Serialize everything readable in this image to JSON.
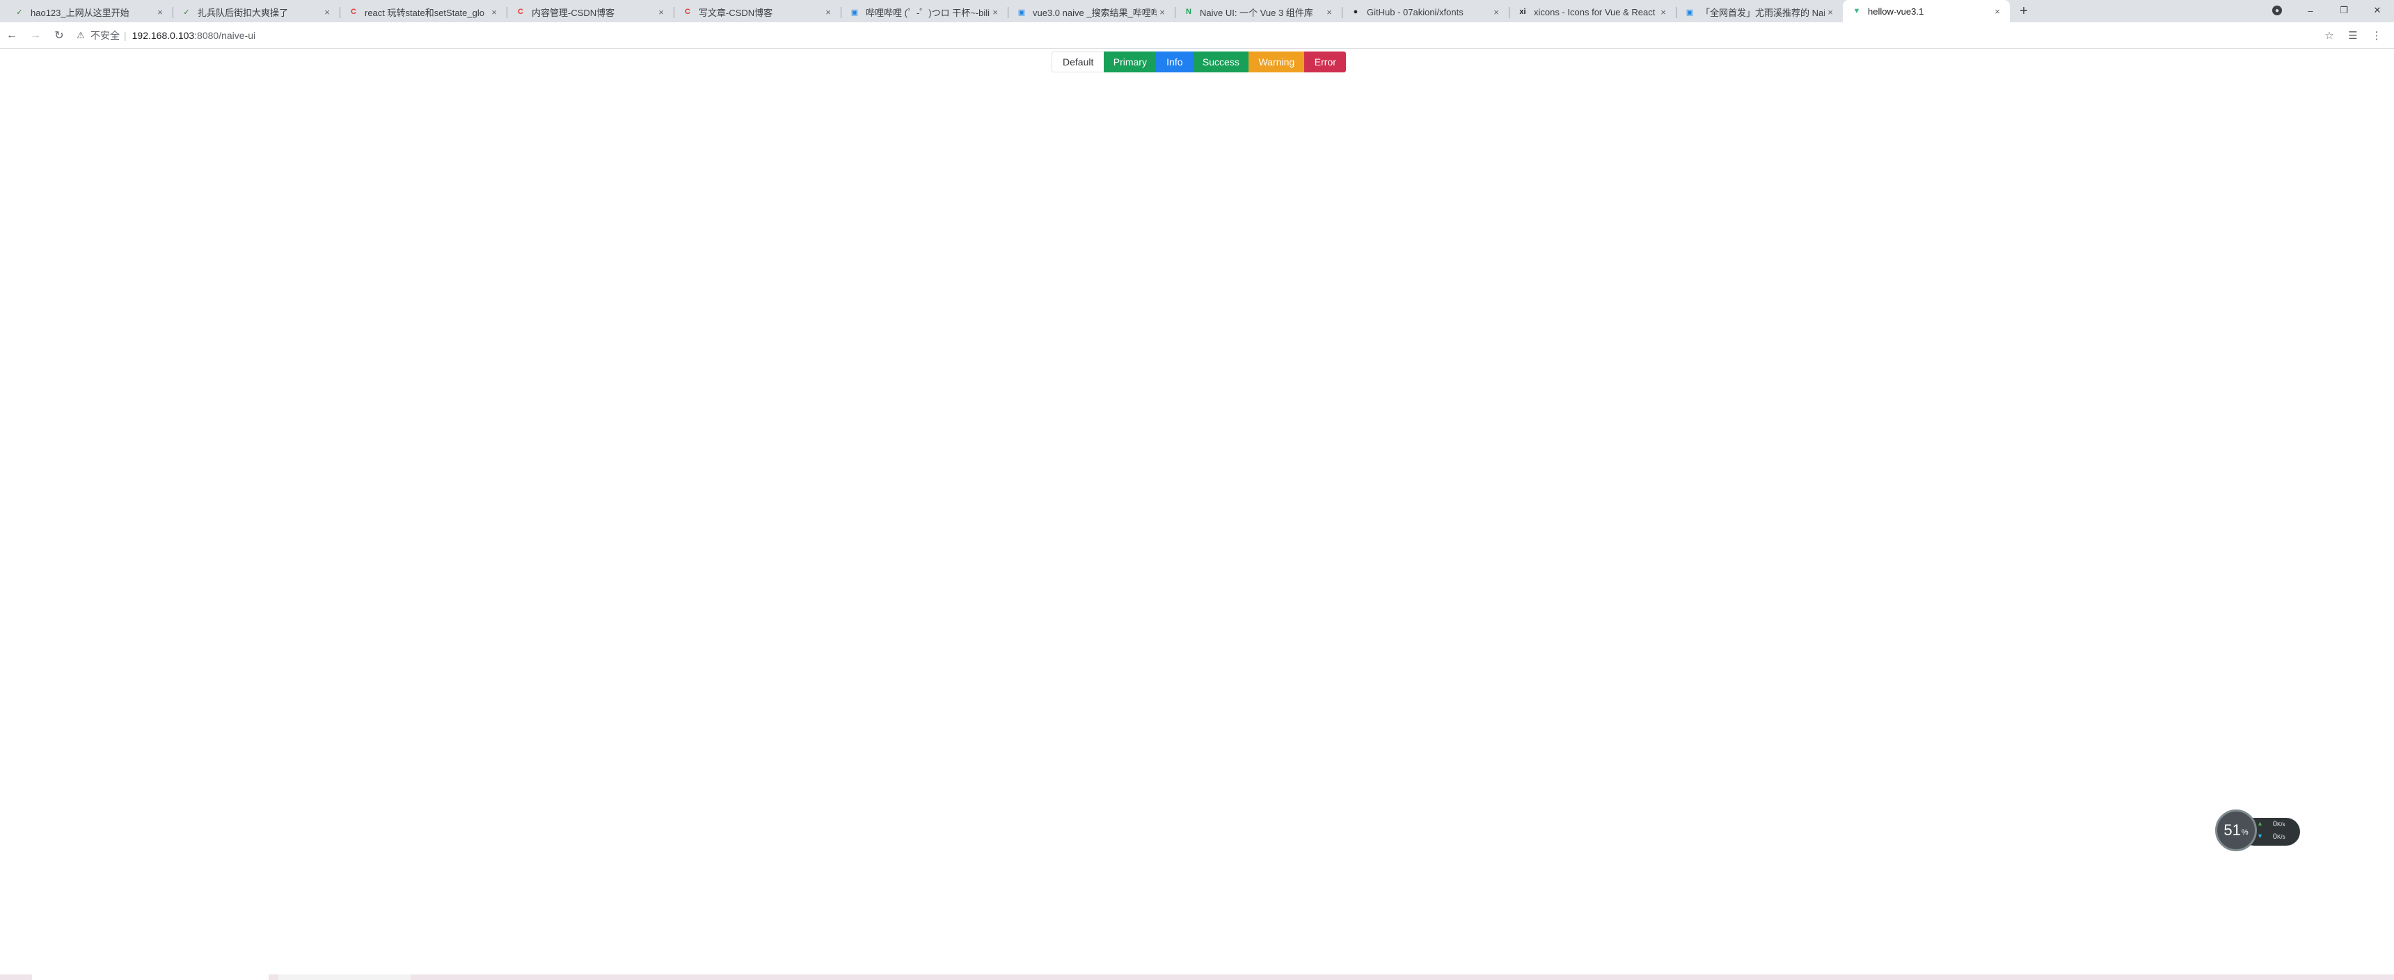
{
  "browser": {
    "tabs": [
      {
        "title": "hao123_上网从这里开始",
        "icon": "hao123-icon",
        "glyph": "✓",
        "color": "#2e7d32",
        "active": false
      },
      {
        "title": "扎兵队后街扣大爽操了",
        "icon": "hao123-icon",
        "glyph": "✓",
        "color": "#2e7d32",
        "active": false
      },
      {
        "title": "react 玩转state和setState_glo",
        "icon": "csdn-icon",
        "glyph": "C",
        "color": "#e53935",
        "active": false
      },
      {
        "title": "内容管理-CSDN博客",
        "icon": "csdn-icon",
        "glyph": "C",
        "color": "#e53935",
        "active": false
      },
      {
        "title": "写文章-CSDN博客",
        "icon": "csdn-icon",
        "glyph": "C",
        "color": "#e53935",
        "active": false
      },
      {
        "title": "哔哩哔哩 (゜-゜)つロ 干杯~-bili",
        "icon": "bilibili-icon",
        "glyph": "▣",
        "color": "#1e88e5",
        "active": false
      },
      {
        "title": "vue3.0 naive _搜索结果_哔哩哔",
        "icon": "bilibili-icon",
        "glyph": "▣",
        "color": "#1e88e5",
        "active": false
      },
      {
        "title": "Naive UI: 一个 Vue 3 组件库",
        "icon": "naive-ui-icon",
        "glyph": "N",
        "color": "#18a058",
        "active": false
      },
      {
        "title": "GitHub - 07akioni/xfonts",
        "icon": "github-icon",
        "glyph": "●",
        "color": "#24292e",
        "active": false
      },
      {
        "title": "xicons - Icons for Vue & React",
        "icon": "xicons-icon",
        "glyph": "xi",
        "color": "#202124",
        "active": false
      },
      {
        "title": "「全网首发」尤雨溪推荐的 Nai",
        "icon": "bilibili-icon",
        "glyph": "▣",
        "color": "#1e88e5",
        "active": false
      },
      {
        "title": "hellow-vue3.1",
        "icon": "vue-icon",
        "glyph": "▼",
        "color": "#42b883",
        "active": true
      }
    ],
    "close_glyph": "×",
    "new_tab_glyph": "+",
    "window": {
      "minimize": "–",
      "restore": "❐",
      "close": "✕"
    },
    "address": {
      "insecure_label": "不安全",
      "separator": "|",
      "url_host": "192.168.0.103",
      "url_rest": ":8080/naive-ui"
    }
  },
  "page": {
    "buttons": [
      {
        "label": "Default",
        "type": "default"
      },
      {
        "label": "Primary",
        "type": "primary"
      },
      {
        "label": "Info",
        "type": "info"
      },
      {
        "label": "Success",
        "type": "success"
      },
      {
        "label": "Warning",
        "type": "warning"
      },
      {
        "label": "Error",
        "type": "error"
      }
    ]
  },
  "widget": {
    "value": "51",
    "unit": "%",
    "up": {
      "value": "0",
      "unit": "K/s"
    },
    "down": {
      "value": "0",
      "unit": "K/s"
    }
  },
  "colors": {
    "primary": "#18a058",
    "info": "#2080f0",
    "success": "#18a058",
    "warning": "#f0a020",
    "error": "#d03050"
  }
}
